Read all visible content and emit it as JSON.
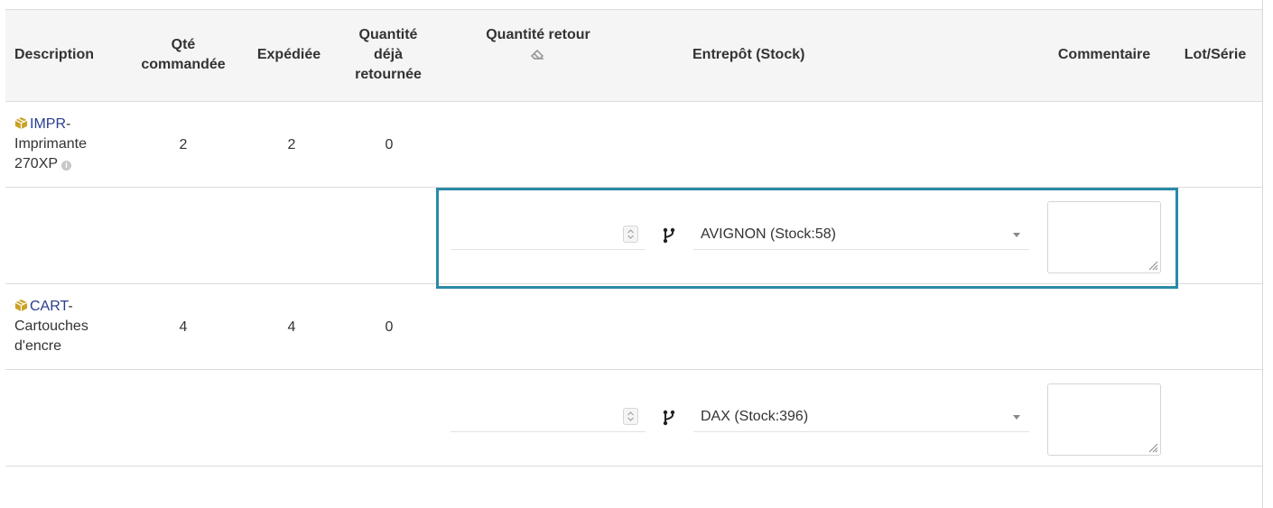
{
  "headers": {
    "description": "Description",
    "qty_ordered": [
      "Qté",
      "commandée"
    ],
    "shipped": "Expédiée",
    "qty_returned": [
      "Quantité",
      "déjà",
      "retournée"
    ],
    "return_qty": "Quantité retour",
    "warehouse": "Entrepôt (Stock)",
    "comment": "Commentaire",
    "lot_serial": "Lot/Série"
  },
  "rows": [
    {
      "ref": "IMPR",
      "label_lines": [
        "- ",
        "Imprimante",
        "270XP"
      ],
      "qty_ordered": "2",
      "shipped": "2",
      "returned": "0",
      "return_qty": "",
      "warehouse": "AVIGNON (Stock:58)",
      "comment": ""
    },
    {
      "ref": "CART",
      "label_lines": [
        "- ",
        "Cartouches",
        "d'encre"
      ],
      "qty_ordered": "4",
      "shipped": "4",
      "returned": "0",
      "return_qty": "",
      "warehouse": "DAX (Stock:396)",
      "comment": ""
    }
  ],
  "icons": {
    "product": "package-icon",
    "info": "info-icon",
    "eraser": "eraser-icon",
    "fork": "branch-fork-icon"
  },
  "colors": {
    "product_ref": "#2a3d8f",
    "package": "#c9a227",
    "highlight": "#2a8aa6",
    "header_bg": "#f5f5f5"
  }
}
